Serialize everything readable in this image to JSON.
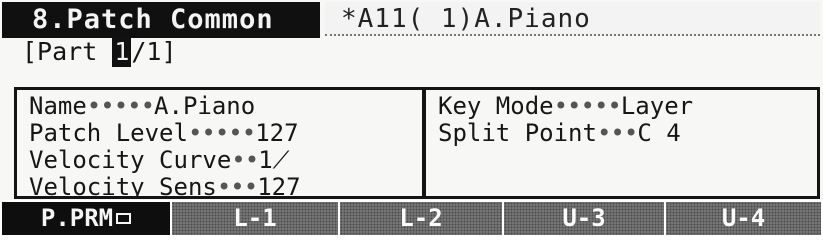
{
  "header": {
    "title": "8.Patch Common",
    "patch_id": "*A11(  1)A.Piano"
  },
  "part": {
    "prefix": "[Part ",
    "current": "1",
    "suffix": "/1]"
  },
  "left_panel": {
    "params": [
      {
        "label": "Name",
        "dots": "•••••",
        "value": "A.Piano"
      },
      {
        "label": "Patch Level",
        "dots": "•••••",
        "value": "127"
      },
      {
        "label": "Velocity Curve",
        "dots": "••",
        "value": "1⟋"
      },
      {
        "label": "Velocity Sens",
        "dots": "•••",
        "value": "127"
      }
    ]
  },
  "right_panel": {
    "params": [
      {
        "label": "Key Mode",
        "dots": "•••••",
        "value": "Layer"
      },
      {
        "label": "Split Point",
        "dots": "•••",
        "value": "C 4"
      }
    ]
  },
  "tabs": [
    {
      "label": "P.PRM",
      "active": true,
      "icon": "page-icon"
    },
    {
      "label": "L-1",
      "active": false
    },
    {
      "label": "L-2",
      "active": false
    },
    {
      "label": "U-3",
      "active": false
    },
    {
      "label": "U-4",
      "active": false
    }
  ]
}
